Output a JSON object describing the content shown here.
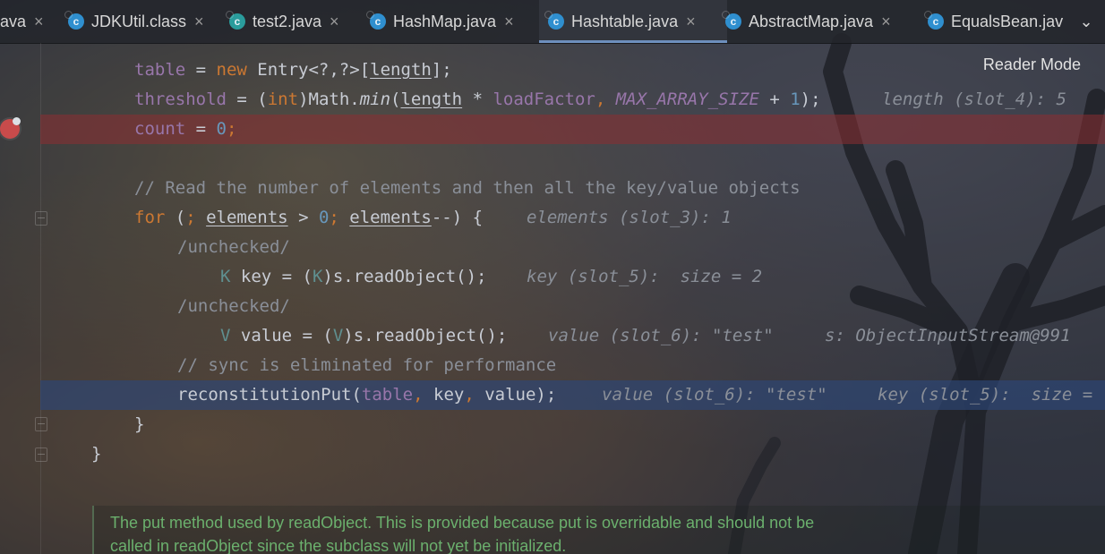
{
  "tabs": [
    {
      "label": "ava",
      "has_icon": false,
      "icon": "",
      "active": false
    },
    {
      "label": "JDKUtil.class",
      "has_icon": true,
      "icon": "class-file-icon",
      "active": false
    },
    {
      "label": "test2.java",
      "has_icon": true,
      "icon": "java-test-file-icon",
      "active": false
    },
    {
      "label": "HashMap.java",
      "has_icon": true,
      "icon": "java-file-icon",
      "active": false
    },
    {
      "label": "Hashtable.java",
      "has_icon": true,
      "icon": "java-file-icon",
      "active": true
    },
    {
      "label": "AbstractMap.java",
      "has_icon": true,
      "icon": "java-file-icon",
      "active": false
    },
    {
      "label": "EqualsBean.jav",
      "has_icon": true,
      "icon": "java-file-icon",
      "active": false
    }
  ],
  "tab_close_glyph": "×",
  "tab_icon_glyph": "c",
  "tabs_chevron_glyph": "⌄",
  "reader_mode_label": "Reader Mode",
  "code": {
    "table_kw": "table",
    "eq": " = ",
    "new_kw": "new",
    "entry_array": " Entry<?,?>[",
    "length": "length",
    "bracket_end": "];",
    "threshold": "threshold",
    "int_kw": "int",
    "math_min_prefix": ")Math.",
    "min": "min",
    "open_paren": "(",
    "mul": " * ",
    "loadFactor": "loadFactor",
    "comma_space": ", ",
    "max_array_size": "MAX_ARRAY_SIZE",
    "plus": " + ",
    "one": "1",
    "close_paren_semicolon": ");",
    "hint_length": "length (slot_4): 5",
    "count": "count",
    "zero": "0",
    "semicolon": ";",
    "comment_read": "// Read the number of elements and then all the key/value objects",
    "for_kw": "for",
    "for_open": " (",
    "for_semicolon": "; ",
    "elements": "elements",
    "gt": " > ",
    "decrement": "--) {",
    "hint_elements": "elements (slot_3): 1",
    "unchecked": "/unchecked/",
    "key_type": "K",
    "key_decl": " key = (",
    "key_cast": "K",
    "read_object": ")s.readObject();",
    "hint_key": "key (slot_5):  size = 2",
    "value_type": "V",
    "value_decl": " value = (",
    "value_cast": "V",
    "hint_value_test": "value (slot_6): \"test\"",
    "hint_s_stream": "s: ObjectInputStream@991",
    "comment_sync": "// sync is eliminated for performance",
    "reconstitution_put": "reconstitutionPut(",
    "key": "key",
    "value": "value",
    "hint_value_test_2": "value (slot_6): \"test\"",
    "hint_key_size": "key (slot_5):  size =",
    "close_brace": "}",
    "close_brace_outer": "}"
  },
  "doc_comment": {
    "line1": "The put method used by readObject. This is provided because put is overridable and should not be",
    "line2": "called in readObject since the subclass will not yet be initialized."
  }
}
